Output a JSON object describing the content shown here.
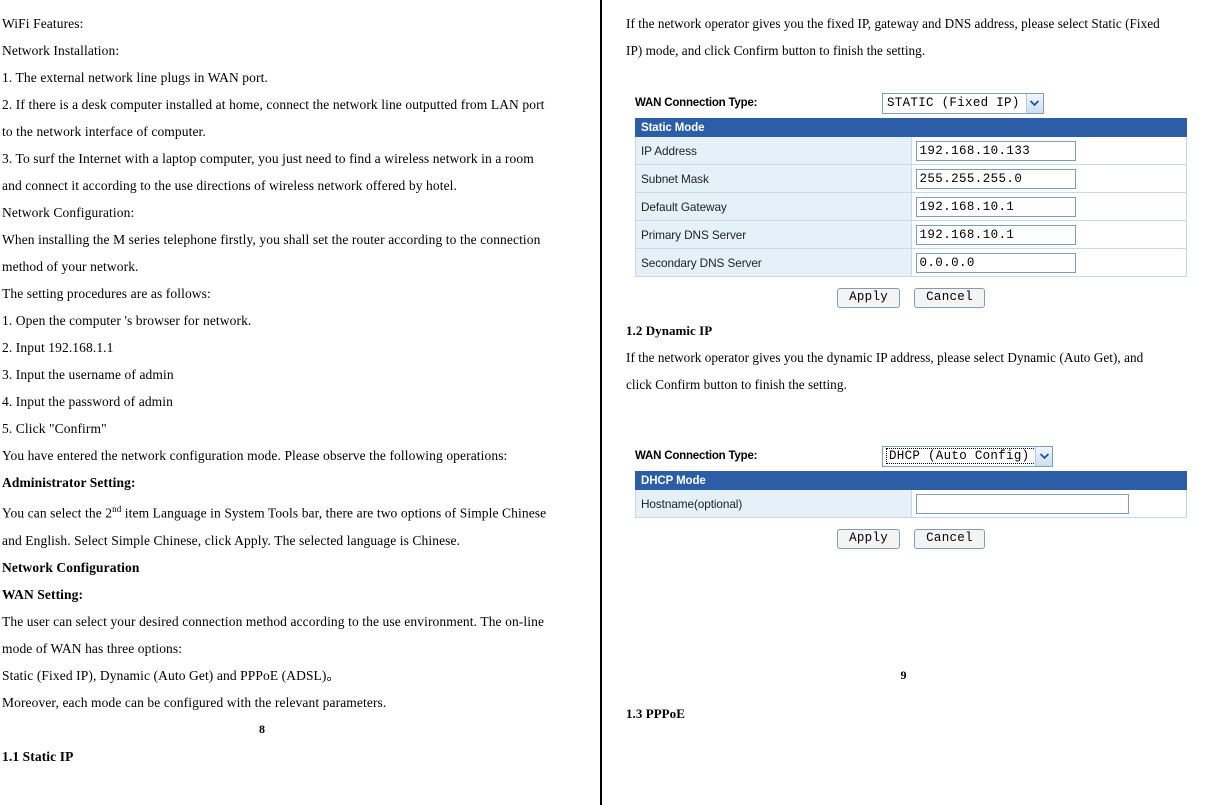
{
  "left_column": {
    "lines": [
      {
        "text": "WiFi Features:",
        "bold": false
      },
      {
        "text": "Network Installation:",
        "bold": false
      },
      {
        "text": "1. The external network line plugs in WAN port.",
        "bold": false
      },
      {
        "text": "2. If there is a desk computer installed at home, connect the network line outputted from LAN port",
        "bold": false
      },
      {
        "text": "to the network interface of computer.",
        "bold": false
      },
      {
        "text": "3. To surf the Internet with a laptop computer, you just need to find a wireless network in a room",
        "bold": false
      },
      {
        "text": "and connect it according to the use directions of wireless network offered by hotel.",
        "bold": false
      },
      {
        "text": "Network Configuration:",
        "bold": false
      },
      {
        "text": "When installing the M series telephone firstly, you shall set the router according to the connection",
        "bold": false
      },
      {
        "text": "method of your network.",
        "bold": false
      },
      {
        "text": "The setting procedures are as follows:",
        "bold": false
      },
      {
        "text": "1. Open the computer 's browser for network.",
        "bold": false
      },
      {
        "text": "2. Input 192.168.1.1",
        "bold": false
      },
      {
        "text": "3. Input the username of admin",
        "bold": false
      },
      {
        "text": "4. Input the password of admin",
        "bold": false
      },
      {
        "text": "5. Click \"Confirm\"",
        "bold": false
      },
      {
        "text": "You have entered the network configuration mode. Please observe the following operations:",
        "bold": false
      }
    ],
    "admin_setting_heading": "Administrator Setting:",
    "admin_line_1_pre": "You can select the 2",
    "admin_line_1_sup": "nd",
    "admin_line_1_post": " item Language in System Tools bar, there are two options of Simple Chinese",
    "admin_line_2": "and English. Select Simple Chinese, click Apply. The selected language is Chinese.",
    "network_configuration_heading": "Network Configuration",
    "wan_setting_heading": "WAN Setting:",
    "tail_lines": [
      {
        "text": "The user can select your desired connection method according to the use environment. The on-line",
        "bold": false
      },
      {
        "text": "mode of WAN has three options:",
        "bold": false
      },
      {
        "text": "Static (Fixed IP), Dynamic (Auto Get) and PPPoE (ADSL)。",
        "bold": false
      },
      {
        "text": "Moreover, each mode can be configured with the relevant parameters.",
        "bold": false
      }
    ],
    "page_number": "8",
    "section_heading": "1.1 Static IP"
  },
  "right_column": {
    "intro_lines": [
      "If the network operator gives you the fixed IP, gateway and DNS address, please select Static (Fixed",
      "IP) mode, and click Confirm button to finish the setting."
    ],
    "static_widget": {
      "wan_connection_label": "WAN Connection Type:",
      "selected_option": "STATIC (Fixed IP)",
      "options": [
        "STATIC (Fixed IP)",
        "DHCP (Auto Config)",
        "PPPoE (ADSL)"
      ],
      "table_header": "Static Mode",
      "rows": [
        {
          "label": "IP Address",
          "value": "192.168.10.133"
        },
        {
          "label": "Subnet Mask",
          "value": "255.255.255.0"
        },
        {
          "label": "Default Gateway",
          "value": "192.168.10.1"
        },
        {
          "label": "Primary DNS Server",
          "value": "192.168.10.1"
        },
        {
          "label": "Secondary DNS Server",
          "value": "0.0.0.0"
        }
      ],
      "apply_label": "Apply",
      "cancel_label": "Cancel"
    },
    "dynamic_heading": "1.2 Dynamic IP",
    "dynamic_lines": [
      "If the network operator gives you the dynamic IP address, please select Dynamic (Auto Get), and",
      "click Confirm button to finish the setting."
    ],
    "dhcp_widget": {
      "wan_connection_label": "WAN Connection Type:",
      "selected_option": "DHCP (Auto Config)",
      "options": [
        "STATIC (Fixed IP)",
        "DHCP (Auto Config)",
        "PPPoE (ADSL)"
      ],
      "table_header": "DHCP Mode",
      "rows": [
        {
          "label": "Hostname(optional)",
          "value": ""
        }
      ],
      "apply_label": "Apply",
      "cancel_label": "Cancel"
    },
    "page_number": "9",
    "section_heading": "1.3   PPPoE"
  },
  "colors": {
    "table_header_blue": "#2b5ea7",
    "label_cell_blue": "#e4f1f9",
    "field_border": "#7f9db9",
    "divider": "#000000"
  }
}
